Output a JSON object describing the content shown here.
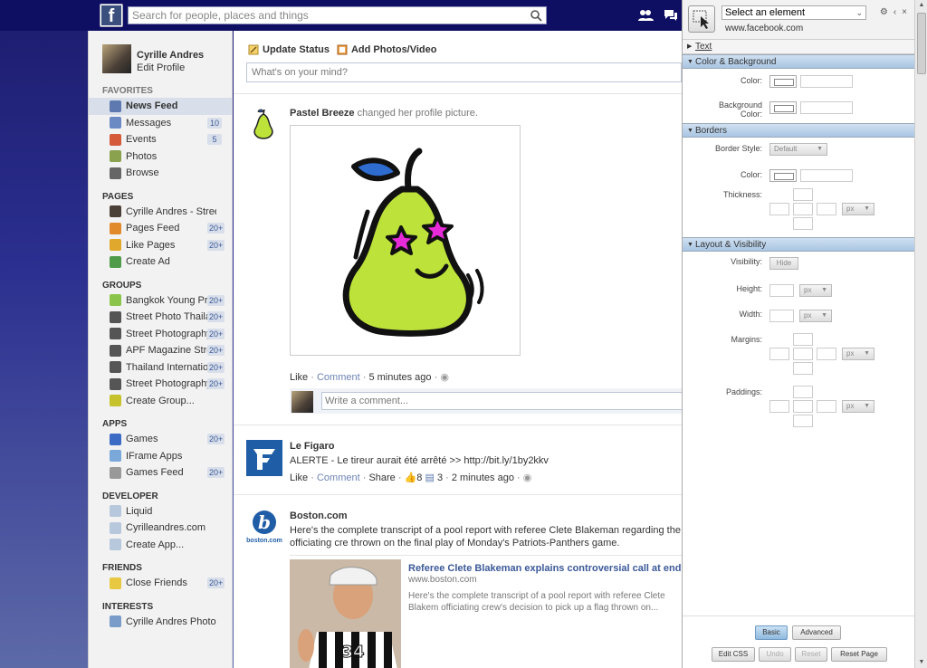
{
  "topbar": {
    "logo_letter": "f",
    "search_placeholder": "Search for people, places and things"
  },
  "profile": {
    "name": "Cyrille Andres",
    "edit": "Edit Profile"
  },
  "sidebar": {
    "favorites_title": "FAVORITES",
    "favorites": [
      {
        "label": "News Feed",
        "badge": "",
        "color": "#5d79b0"
      },
      {
        "label": "Messages",
        "badge": "10",
        "color": "#6b8ac4"
      },
      {
        "label": "Events",
        "badge": "5",
        "color": "#d45a3a"
      },
      {
        "label": "Photos",
        "badge": "",
        "color": "#8aa14e"
      },
      {
        "label": "Browse",
        "badge": "",
        "color": "#666666"
      }
    ],
    "pages_title": "PAGES",
    "pages": [
      {
        "label": "Cyrille Andres - Street P...",
        "badge": "",
        "color": "#4b4037"
      },
      {
        "label": "Pages Feed",
        "badge": "20+",
        "color": "#e08a2c"
      },
      {
        "label": "Like Pages",
        "badge": "20+",
        "color": "#e0a82c"
      },
      {
        "label": "Create Ad",
        "badge": "",
        "color": "#4f9b4a"
      }
    ],
    "groups_title": "GROUPS",
    "groups": [
      {
        "label": "Bangkok Young Pr...",
        "badge": "20+",
        "color": "#8ac44a"
      },
      {
        "label": "Street Photo Thaila...",
        "badge": "20+",
        "color": "#555555"
      },
      {
        "label": "Street Photography",
        "badge": "20+",
        "color": "#555555"
      },
      {
        "label": "APF Magazine Stre...",
        "badge": "20+",
        "color": "#555555"
      },
      {
        "label": "Thailand Internatio...",
        "badge": "20+",
        "color": "#555555"
      },
      {
        "label": "Street Photography",
        "badge": "20+",
        "color": "#555555"
      },
      {
        "label": "Create Group...",
        "badge": "",
        "color": "#c6c22c"
      }
    ],
    "apps_title": "APPS",
    "apps": [
      {
        "label": "Games",
        "badge": "20+",
        "color": "#3b6bc4"
      },
      {
        "label": "IFrame Apps",
        "badge": "",
        "color": "#7aa8d8"
      },
      {
        "label": "Games Feed",
        "badge": "20+",
        "color": "#999999"
      }
    ],
    "developer_title": "DEVELOPER",
    "developer": [
      {
        "label": "Liquid",
        "badge": "",
        "color": "#b8c8dc"
      },
      {
        "label": "Cyrilleandres.com",
        "badge": "",
        "color": "#b8c8dc"
      },
      {
        "label": "Create App...",
        "badge": "",
        "color": "#b8c8dc"
      }
    ],
    "friends_title": "FRIENDS",
    "friends": [
      {
        "label": "Close Friends",
        "badge": "20+",
        "color": "#e8c840"
      }
    ],
    "interests_title": "INTERESTS",
    "interests": [
      {
        "label": "Cyrille Andres Photos",
        "badge": "",
        "color": "#7a9cc8"
      }
    ]
  },
  "composer": {
    "update_status": "Update Status",
    "add_photos": "Add Photos/Video",
    "placeholder": "What's on your mind?"
  },
  "story1": {
    "actor": "Pastel Breeze",
    "action": "changed her profile picture.",
    "like": "Like",
    "comment": "Comment",
    "time": "5 minutes ago",
    "comment_placeholder": "Write a comment..."
  },
  "story2": {
    "actor": "Le Figaro",
    "text": "ALERTE - Le tireur aurait été arrêté >> http://bit.ly/1by2kkv",
    "like": "Like",
    "comment": "Comment",
    "share": "Share",
    "likes_count": "8",
    "comments_count": "3",
    "time": "2 minutes ago"
  },
  "story3": {
    "actor": "Boston.com",
    "text": "Here's the complete transcript of a pool report with referee Clete Blakeman regarding the officiating cre thrown on the final play of Monday's Patriots-Panthers game.",
    "logo_text": "boston.com",
    "link_title": "Referee Clete Blakeman explains controversial call at end of...",
    "link_domain": "www.boston.com",
    "link_desc": "Here's the complete transcript of a pool report with referee Clete Blakem officiating crew's decision to pick up a flag thrown on...",
    "jersey_number": "34"
  },
  "panel": {
    "select_placeholder": "Select an element",
    "url": "www.facebook.com",
    "sec_text": "Text",
    "sec_color": "Color & Background",
    "color_label": "Color:",
    "bg_label_1": "Background",
    "bg_label_2": "Color:",
    "sec_borders": "Borders",
    "border_style_label": "Border Style:",
    "border_style_value": "Default",
    "border_color_label": "Color:",
    "thickness_label": "Thickness:",
    "unit": "px",
    "sec_layout": "Layout & Visibility",
    "visibility_label": "Visibility:",
    "hide": "Hide",
    "height_label": "Height:",
    "width_label": "Width:",
    "margins_label": "Margins:",
    "paddings_label": "Paddings:",
    "basic": "Basic",
    "advanced": "Advanced",
    "edit_css": "Edit CSS",
    "undo": "Undo",
    "reset": "Reset",
    "reset_page": "Reset Page"
  },
  "colors": {
    "header": "#0e0e63",
    "link": "#3b5998",
    "panel_header": "#a9c5e3"
  }
}
